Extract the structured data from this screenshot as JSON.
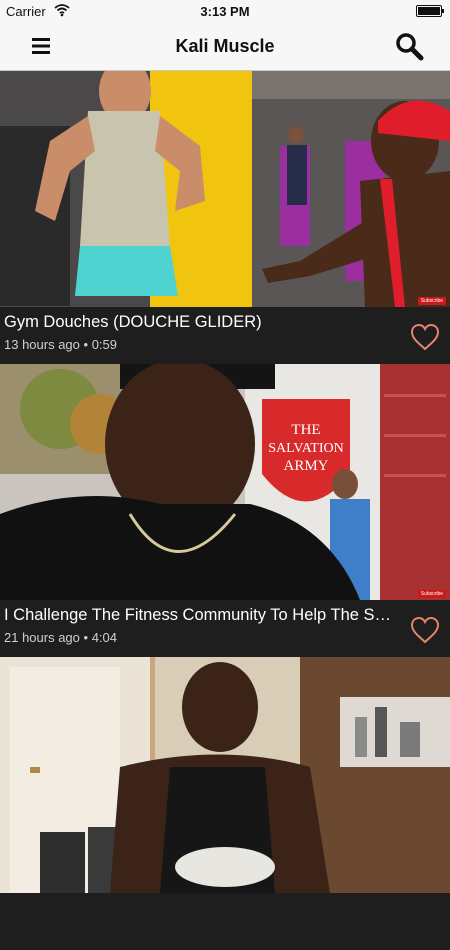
{
  "status_bar": {
    "carrier": "Carrier",
    "time": "3:13 PM"
  },
  "nav": {
    "title": "Kali Muscle"
  },
  "videos": [
    {
      "title": "Gym Douches (DOUCHE GLIDER)",
      "age": "13 hours ago",
      "duration": "0:59",
      "subscribe": "Subscribe"
    },
    {
      "title": "I Challenge The Fitness Community To Help The Salvation Army",
      "age": "21 hours ago",
      "duration": "4:04",
      "subscribe": "Subscribe",
      "sign_line1": "THE",
      "sign_line2": "SALVATION",
      "sign_line3": "ARMY"
    },
    {
      "title": "",
      "age": "",
      "duration": ""
    }
  ],
  "colors": {
    "accent": "#e8836b",
    "bar_bg": "#f7f7f7",
    "row_bg": "#1e1e1e"
  }
}
